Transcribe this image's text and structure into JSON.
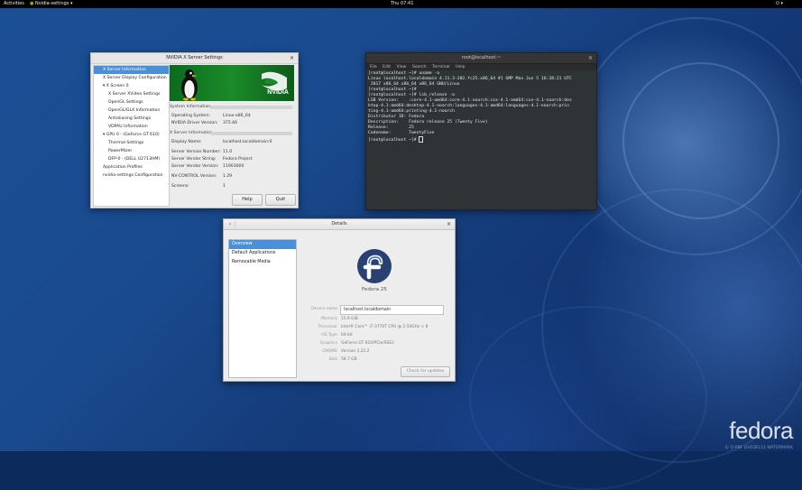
{
  "topbar": {
    "activities": "Activities",
    "app_menu": "Nvidia-settings",
    "app_menu_arrow": "▾",
    "clock": "Thu 07:41",
    "status_icons": "⏻ ▾"
  },
  "nvidia_window": {
    "title": "NVIDIA X Server Settings",
    "close": "×",
    "tree": [
      {
        "label": "X Server Information",
        "indent": 1,
        "selected": true
      },
      {
        "label": "X Server Display Configuration",
        "indent": 1
      },
      {
        "label": "▾ X Screen 0",
        "indent": 1
      },
      {
        "label": "X Server XVideo Settings",
        "indent": 2
      },
      {
        "label": "OpenGL Settings",
        "indent": 2
      },
      {
        "label": "OpenGL/GLX Information",
        "indent": 2
      },
      {
        "label": "Antialiasing Settings",
        "indent": 2
      },
      {
        "label": "VDPAU Information",
        "indent": 2
      },
      {
        "label": "▾ GPU 0 - (GeForce GT 610)",
        "indent": 1
      },
      {
        "label": "Thermal Settings",
        "indent": 2
      },
      {
        "label": "PowerMizer",
        "indent": 2
      },
      {
        "label": "DFP-0 - (DELL U2713HM)",
        "indent": 2
      },
      {
        "label": "Application Profiles",
        "indent": 1
      },
      {
        "label": "nvidia-settings Configuration",
        "indent": 1
      }
    ],
    "banner_text": "NVIDIA",
    "section_system": "System Information",
    "section_xserver": "X Server Information",
    "rows_system": [
      {
        "label": "Operating System:",
        "value": "Linux-x86_64"
      },
      {
        "label": "NVIDIA Driver Version:",
        "value": "375.66"
      }
    ],
    "rows_xserver": [
      {
        "label": "Display Name:",
        "value": "localhost.localdomain:0"
      },
      {
        "label": "Server Version Number:",
        "value": "11.0"
      },
      {
        "label": "Server Vendor String:",
        "value": "Fedora Project"
      },
      {
        "label": "Server Vendor Version:",
        "value": "11903000"
      },
      {
        "label": "NV-CONTROL Version:",
        "value": "1.29"
      },
      {
        "label": "Screens:",
        "value": "1"
      }
    ],
    "help_button": "Help",
    "quit_button": "Quit"
  },
  "terminal": {
    "title": "root@localhost:~",
    "close": "×",
    "menu": [
      "File",
      "Edit",
      "View",
      "Search",
      "Terminal",
      "Help"
    ],
    "lines": [
      "[root@localhost ~]# uname -a",
      "Linux localhost.localdomain 4.11.3-202.fc25.x86_64 #1 SMP Mon Jun 5 16:38:21 UTC",
      " 2017 x86_64 x86_64 x86_64 GNU/Linux",
      "[root@localhost ~]#",
      "[root@localhost ~]# lsb_release -a",
      "LSB Version:    :core-4.1-amd64:core-4.1-noarch:cxx-4.1-amd64:cxx-4.1-noarch:des",
      "ktop-4.1-amd64:desktop-4.1-noarch:languages-4.1-amd64:languages-4.1-noarch:prin",
      "ting-4.1-amd64:printing-4.1-noarch",
      "Distributor ID: Fedora",
      "Description:    Fedora release 25 (Twenty Five)",
      "Release:        25",
      "Codename:       TwentyFive",
      "[root@localhost ~]# "
    ]
  },
  "details_window": {
    "title": "Details",
    "back": "‹",
    "close": "×",
    "nav": [
      {
        "label": "Overview",
        "selected": true
      },
      {
        "label": "Default Applications"
      },
      {
        "label": "Removable Media"
      }
    ],
    "os_name": "Fedora 25",
    "device_name_label": "Device name",
    "device_name_value": "localhost.localdomain",
    "specs": [
      {
        "label": "Memory",
        "value": "15.6 GiB"
      },
      {
        "label": "Processor",
        "value": "Intel® Core™ i7-3770T CPU @ 2.50GHz × 8"
      },
      {
        "label": "OS Type",
        "value": "64-bit"
      },
      {
        "label": "Graphics",
        "value": "GeForce GT 610/PCIe/SSE2"
      },
      {
        "label": "GNOME",
        "value": "Version 3.22.2"
      },
      {
        "label": "Disk",
        "value": "58.7 GB"
      }
    ],
    "check_updates_button": "Check for updates"
  },
  "watermark": {
    "text": "fedora",
    "subtext": "© Q-PBF LIVEDEL11 WATERMARK"
  }
}
